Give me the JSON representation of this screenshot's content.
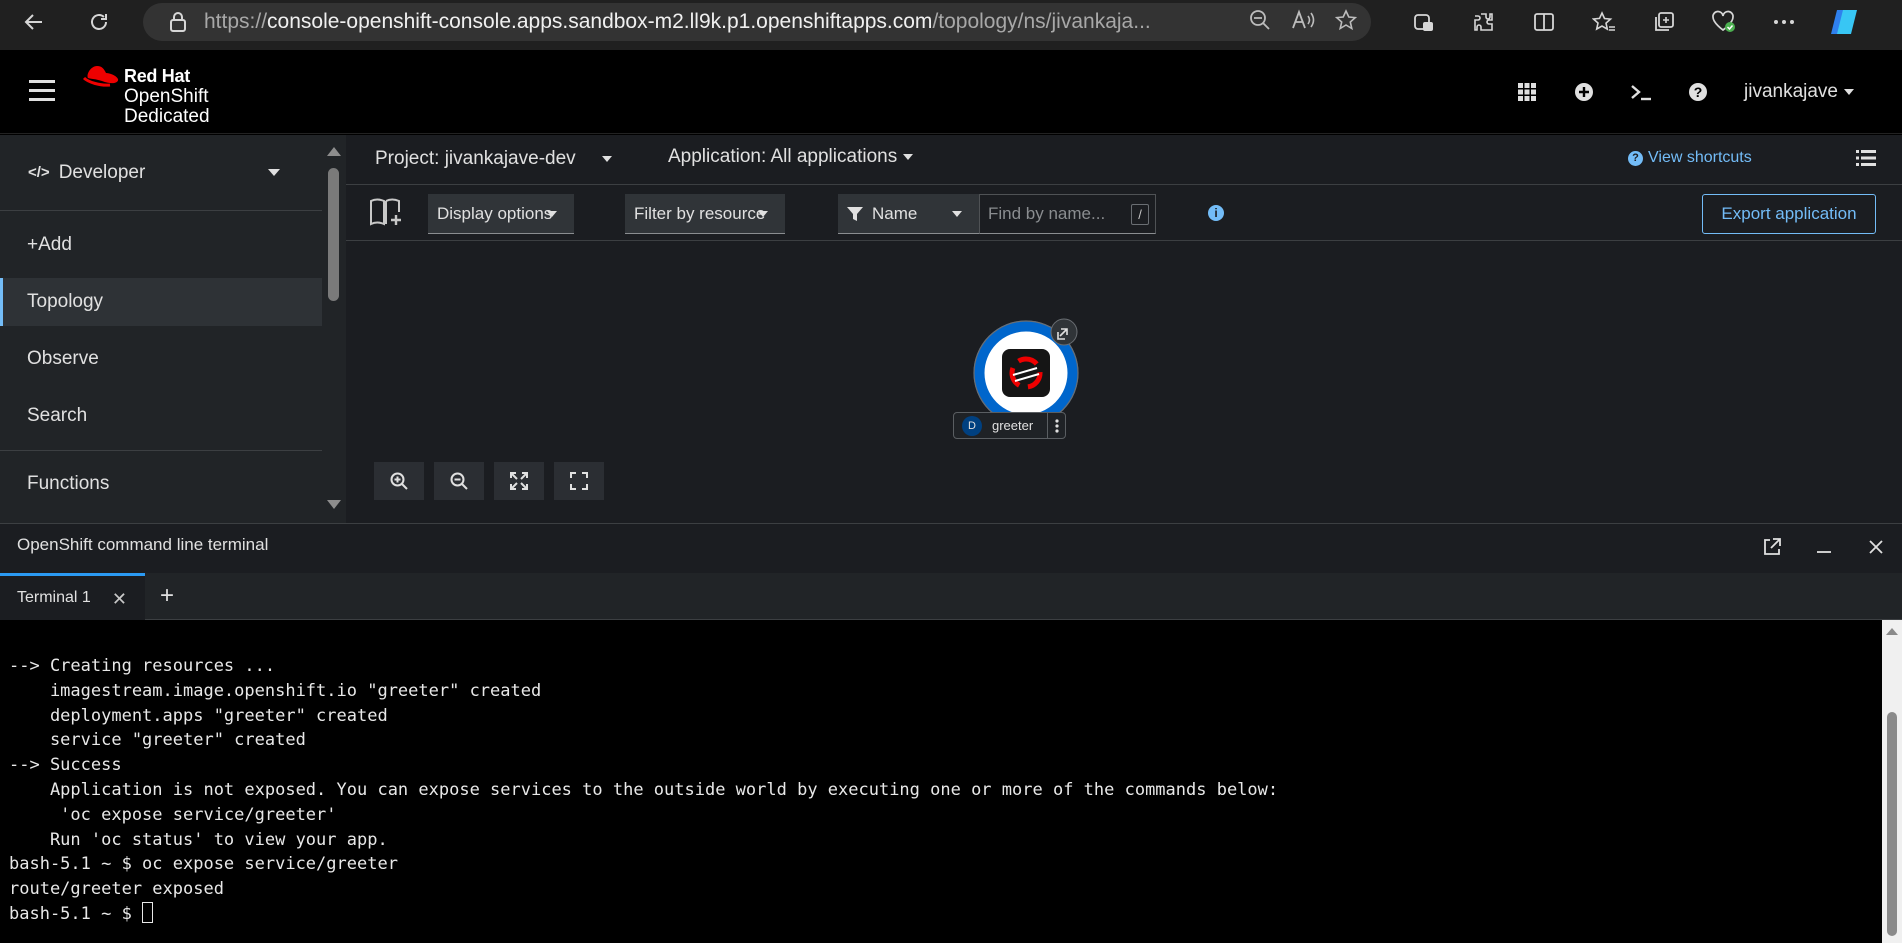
{
  "browser": {
    "url_prefix": "https://",
    "url_host": "console-openshift-console.apps.sandbox-m2.ll9k.p1.openshiftapps.com",
    "url_path": "/topology/ns/jivankaja..."
  },
  "masthead": {
    "brand_line1": "Red Hat",
    "brand_line2": "OpenShift",
    "brand_line3": "Dedicated",
    "user": "jivankajave"
  },
  "sidebar": {
    "perspective": "Developer",
    "items": [
      {
        "label": "+Add"
      },
      {
        "label": "Topology"
      },
      {
        "label": "Observe"
      },
      {
        "label": "Search"
      },
      {
        "label": "Functions"
      }
    ]
  },
  "topbar": {
    "project": "Project: jivankajave-dev",
    "application": "Application: All applications",
    "shortcuts": "View shortcuts"
  },
  "toolbar": {
    "display_options": "Display options",
    "filter_by_resource": "Filter by resource",
    "filter_type": "Name",
    "search_placeholder": "Find by name...",
    "search_hint": "/",
    "export": "Export application"
  },
  "topology": {
    "node_badge": "D",
    "node_name": "greeter"
  },
  "terminal": {
    "title": "OpenShift command line terminal",
    "tab": "Terminal 1",
    "lines": [
      "--> Creating resources ...",
      "    imagestream.image.openshift.io \"greeter\" created",
      "    deployment.apps \"greeter\" created",
      "    service \"greeter\" created",
      "--> Success",
      "    Application is not exposed. You can expose services to the outside world by executing one or more of the commands below:",
      "     'oc expose service/greeter'",
      "    Run 'oc status' to view your app.",
      "bash-5.1 ~ $ oc expose service/greeter",
      "route/greeter exposed"
    ],
    "prompt": "bash-5.1 ~ $ "
  }
}
